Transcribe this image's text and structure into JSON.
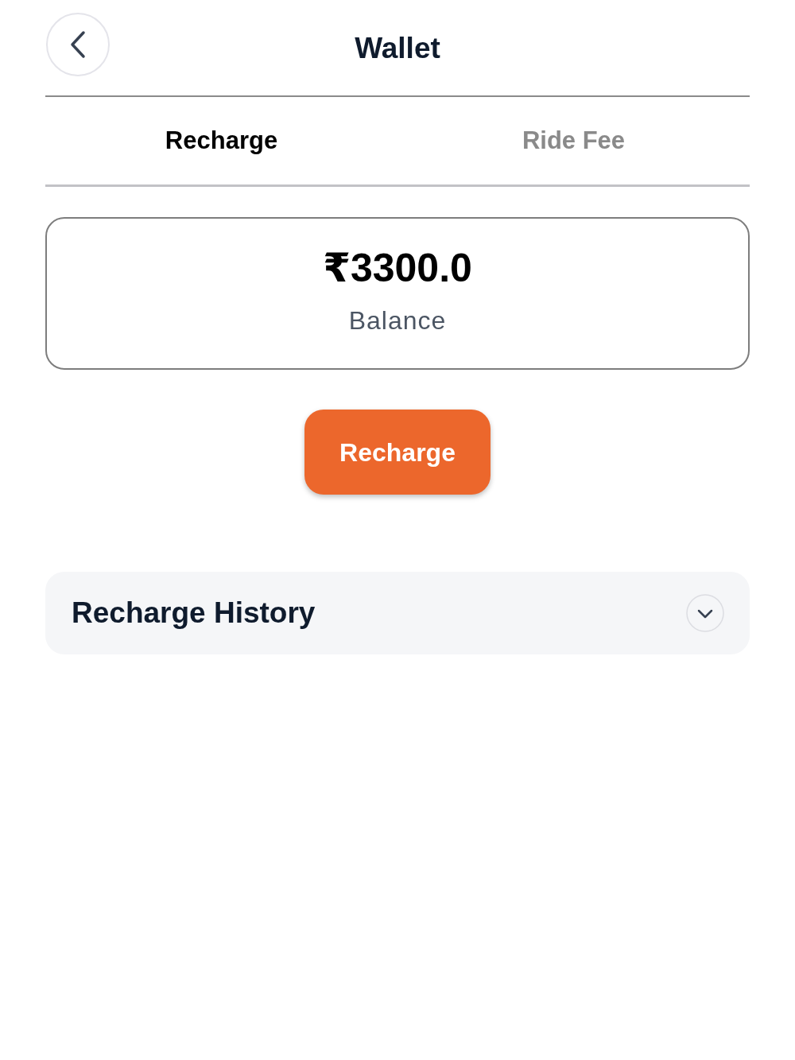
{
  "header": {
    "title": "Wallet"
  },
  "tabs": [
    {
      "label": "Recharge",
      "selected": true
    },
    {
      "label": "Ride Fee",
      "selected": false
    }
  ],
  "balance": {
    "amount": "₹3300.0",
    "label": "Balance"
  },
  "recharge_button": {
    "label": "Recharge"
  },
  "history": {
    "title": "Recharge History",
    "expanded": false
  }
}
